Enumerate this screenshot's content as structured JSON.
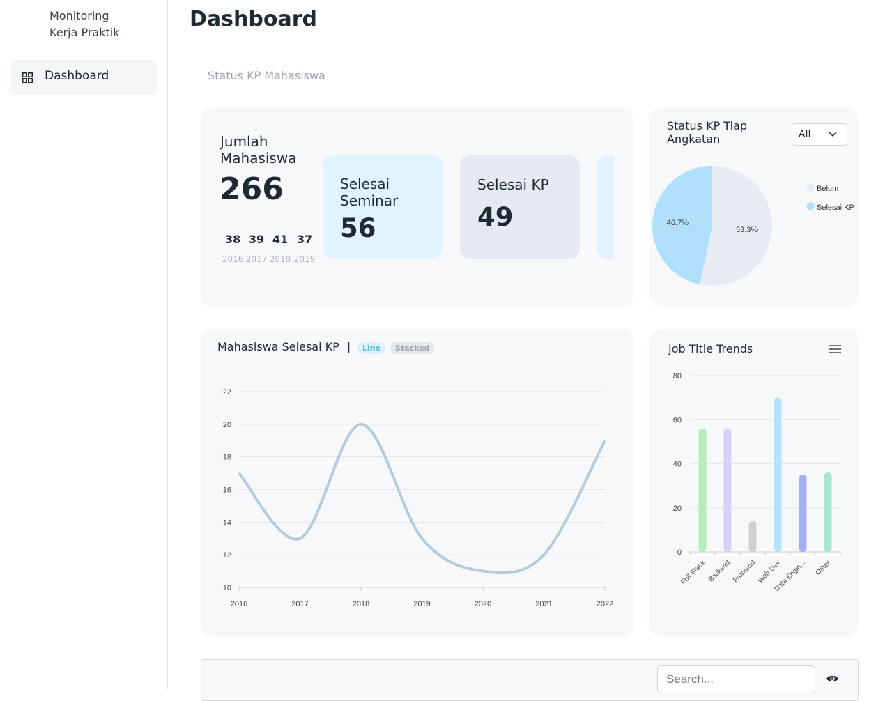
{
  "app": {
    "title_line1": "Monitoring",
    "title_line2": "Kerja Praktik"
  },
  "sidebar": {
    "items": [
      {
        "label": "Dashboard",
        "icon": "grid-icon"
      }
    ]
  },
  "header": {
    "title": "Dashboard"
  },
  "section": {
    "title": "Status KP Mahasiswa"
  },
  "summary": {
    "total_label_line1": "Jumlah",
    "total_label_line2": "Mahasiswa",
    "total_value": "266",
    "years": [
      {
        "count": "38",
        "year": "2016"
      },
      {
        "count": "39",
        "year": "2017"
      },
      {
        "count": "41",
        "year": "2018"
      },
      {
        "count": "37",
        "year": "2019"
      }
    ],
    "tiles": [
      {
        "label_line1": "Selesai",
        "label_line2": "Seminar",
        "value": "56",
        "color": "#e1f3fc"
      },
      {
        "label_line1": "Selesai KP",
        "label_line2": "",
        "value": "49",
        "color": "#e5e9f2"
      }
    ]
  },
  "status_chart": {
    "title_line1": "Status KP Tiap",
    "title_line2": "Angkatan",
    "filter": {
      "selected": "All"
    },
    "chart_data": {
      "type": "pie",
      "labels": [
        "Belum",
        "Selesai KP"
      ],
      "values": [
        53.3,
        46.7
      ],
      "value_labels": [
        "53.3%",
        "46.7%"
      ],
      "colors": [
        "#e6ebf4",
        "#b0e0fb"
      ],
      "legend": "right"
    }
  },
  "line_chart": {
    "title": "Mahasiswa Selesai KP",
    "separator": "|",
    "toggle": {
      "line": "Line",
      "stacked": "Stacked",
      "active": "Line"
    },
    "chart_data": {
      "type": "line",
      "x": [
        "2016",
        "2017",
        "2018",
        "2019",
        "2020",
        "2021",
        "2022"
      ],
      "series": [
        {
          "values": [
            17,
            13,
            20,
            13,
            11,
            12,
            19
          ]
        }
      ],
      "ylim": [
        10,
        22
      ],
      "yticks": [
        10,
        12,
        14,
        16,
        18,
        20,
        22
      ],
      "grid": true,
      "color": "#b4cce0"
    }
  },
  "job_chart": {
    "title": "Job Title Trends",
    "menu_icon": "menu-icon",
    "chart_data": {
      "type": "bar",
      "categories": [
        "Full Stack",
        "Backend",
        "Frontend",
        "Web Dev",
        "Data Engin...",
        "Other"
      ],
      "values": [
        56,
        56,
        14,
        70,
        35,
        36
      ],
      "colors": [
        "#b4ecbb",
        "#d4d2f8",
        "#cfd0d2",
        "#b6e3fc",
        "#a3aef7",
        "#a8e6cf"
      ],
      "ylim": [
        0,
        80
      ],
      "yticks": [
        0,
        20,
        40,
        60,
        80
      ],
      "grid": true
    }
  },
  "table": {
    "search_placeholder": "Search...",
    "visibility_icon": "eye-icon"
  }
}
